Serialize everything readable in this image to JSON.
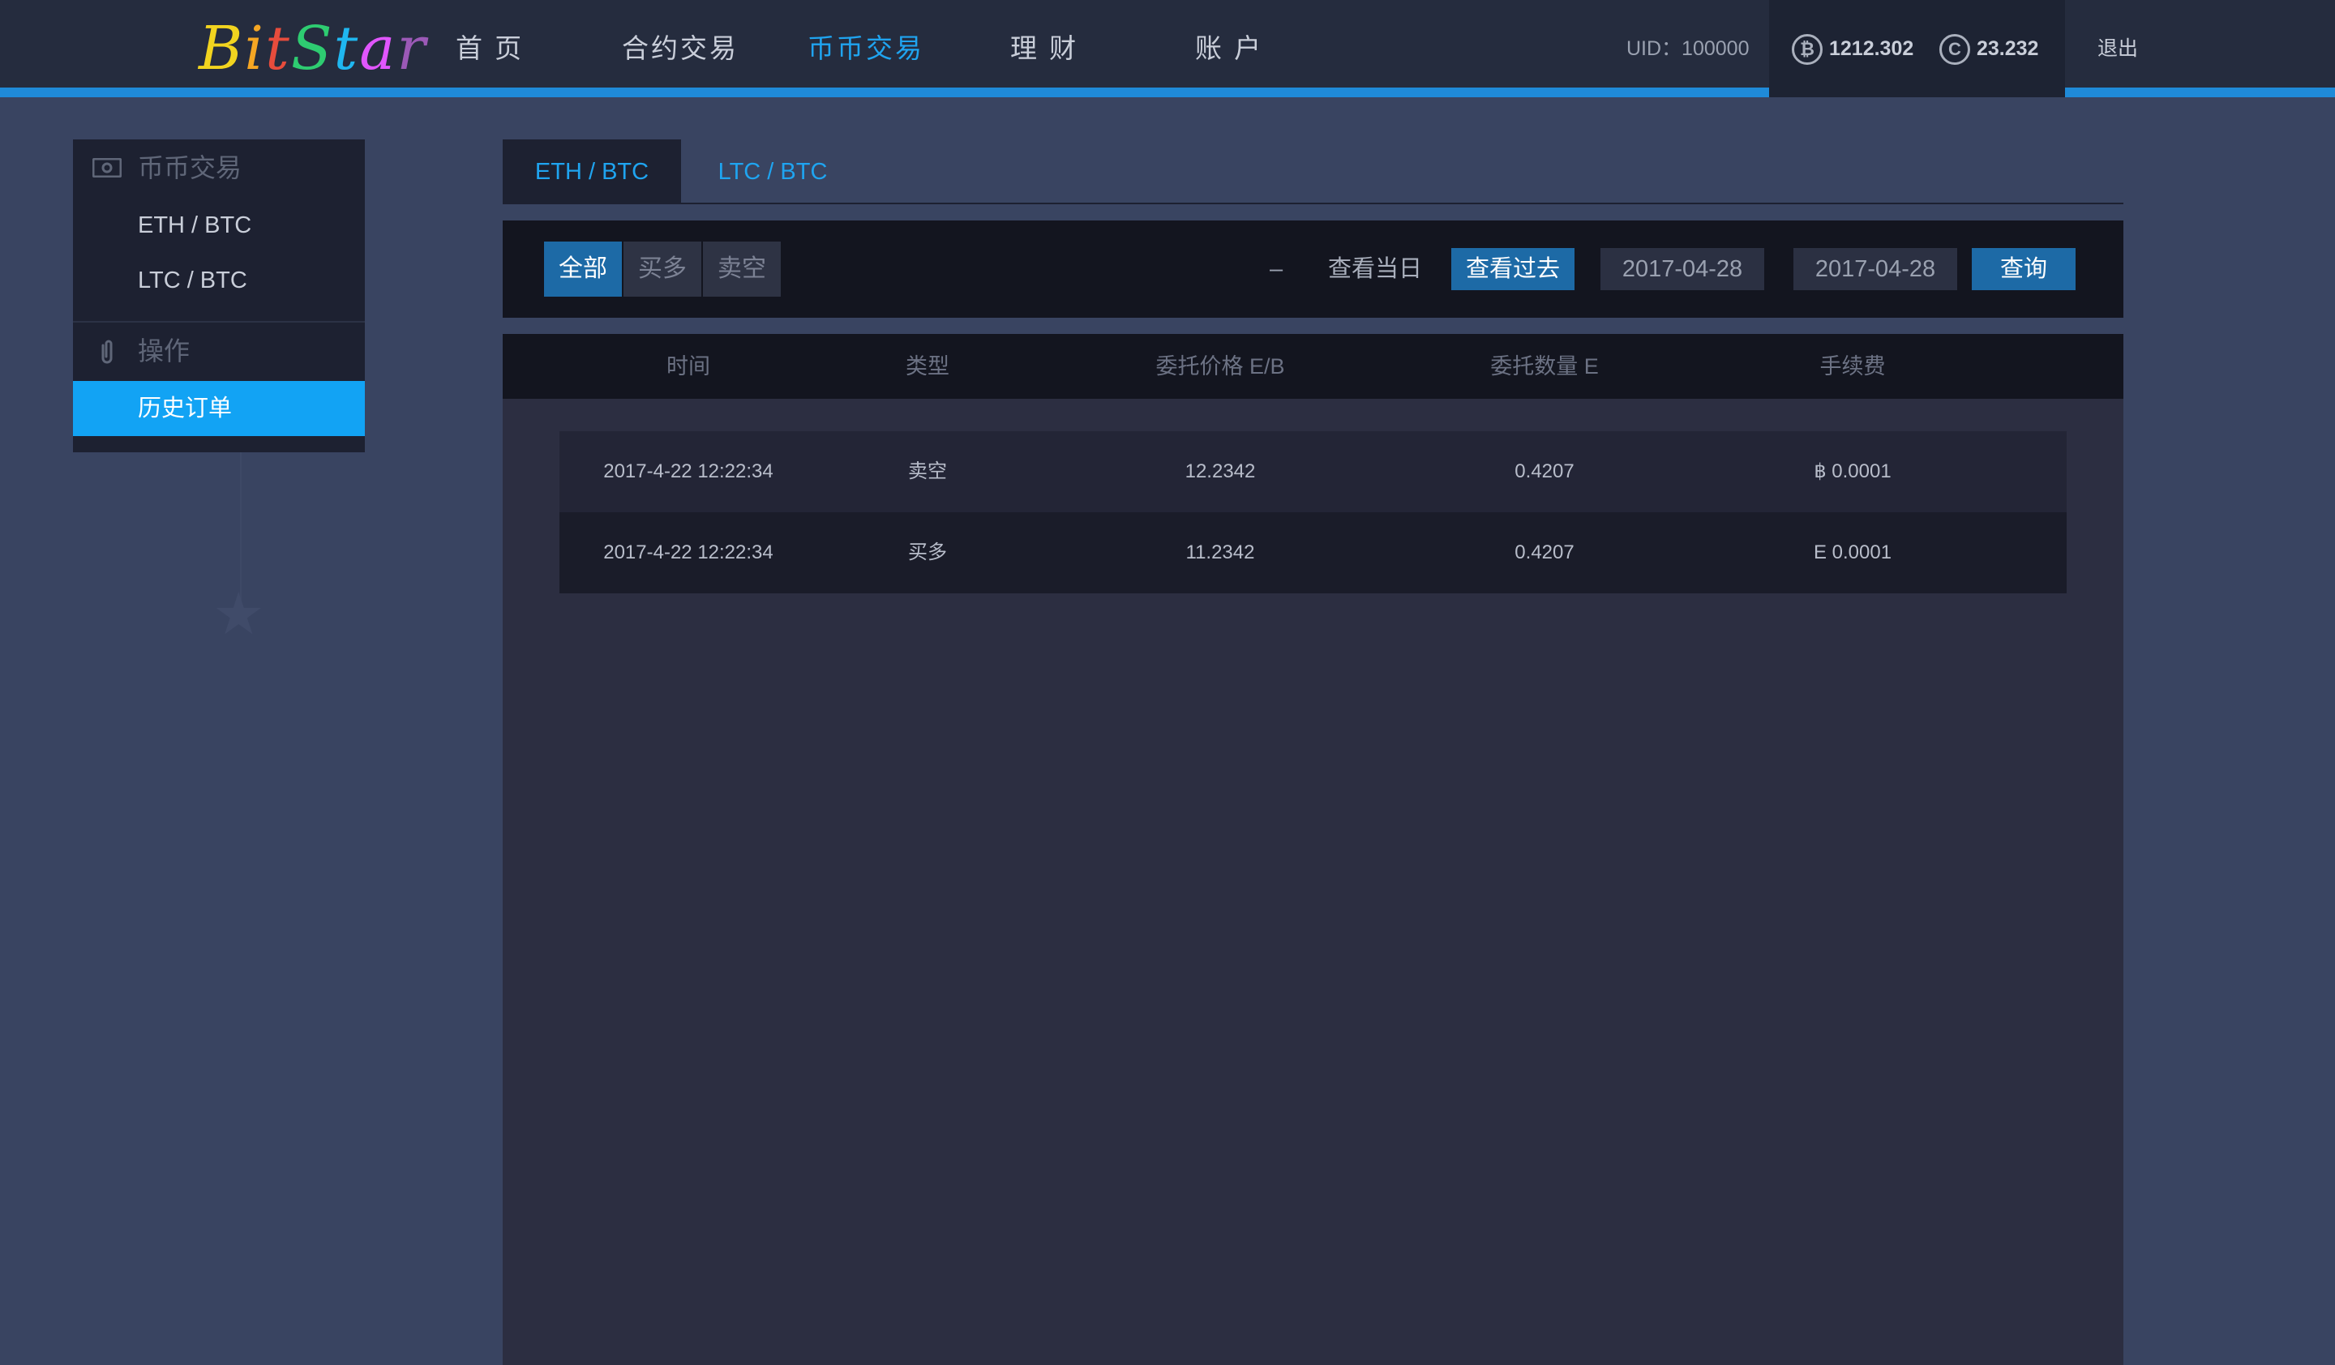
{
  "header": {
    "logo_letters": [
      "B",
      "i",
      "t",
      "S",
      "t",
      "a",
      "r"
    ],
    "nav": [
      "首 页",
      "合约交易",
      "币币交易",
      "理 财",
      "账 户"
    ],
    "active_nav": "币币交易",
    "uid": "UID：100000",
    "btc_balance": "1212.302",
    "btc_icon": "bitcoin-icon",
    "eth_balance": "23.232",
    "eth_icon": "coin-icon",
    "logout": "退出",
    "accent_color": "#1f8ad8"
  },
  "sidebar": {
    "section1_title": "币币交易",
    "section1_icon": "money-icon",
    "section1_items": [
      "ETH / BTC",
      "LTC / BTC"
    ],
    "section2_title": "操作",
    "section2_icon": "paperclip-icon",
    "section2_items": [
      "历史订单"
    ],
    "active_item": "历史订单"
  },
  "tabs": [
    "ETH / BTC",
    "LTC / BTC"
  ],
  "active_tab": "ETH / BTC",
  "filters": {
    "segments": [
      "全部",
      "买多",
      "卖空"
    ],
    "active_segment": "全部",
    "view_today": "查看当日",
    "view_past": "查看过去",
    "date_from": "2017-04-28",
    "date_sep": "–",
    "date_to": "2017-04-28",
    "query": "查询"
  },
  "table": {
    "columns": [
      "时间",
      "类型",
      "委托价格 E/B",
      "委托数量 E",
      "手续费"
    ],
    "rows": [
      [
        "2017-4-22 12:22:34",
        "卖空",
        "12.2342",
        "0.4207",
        "฿ 0.0001"
      ],
      [
        "2017-4-22 12:22:34",
        "买多",
        "11.2342",
        "0.4207",
        "E 0.0001"
      ]
    ]
  }
}
